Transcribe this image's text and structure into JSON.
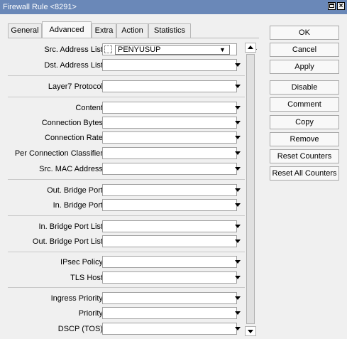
{
  "window": {
    "title": "Firewall Rule <8291>"
  },
  "tabs": [
    {
      "label": "General"
    },
    {
      "label": "Advanced"
    },
    {
      "label": "Extra"
    },
    {
      "label": "Action"
    },
    {
      "label": "Statistics"
    }
  ],
  "fields": {
    "src_address_list": {
      "label": "Src. Address List:",
      "value": "PENYUSUP"
    },
    "dst_address_list": {
      "label": "Dst. Address List:"
    },
    "layer7_protocol": {
      "label": "Layer7 Protocol:"
    },
    "content": {
      "label": "Content:"
    },
    "connection_bytes": {
      "label": "Connection Bytes:"
    },
    "connection_rate": {
      "label": "Connection Rate:"
    },
    "per_connection_classifier": {
      "label": "Per Connection Classifier:"
    },
    "src_mac_address": {
      "label": "Src. MAC Address:"
    },
    "out_bridge_port": {
      "label": "Out. Bridge Port:"
    },
    "in_bridge_port": {
      "label": "In. Bridge Port:"
    },
    "in_bridge_port_list": {
      "label": "In. Bridge Port List:"
    },
    "out_bridge_port_list": {
      "label": "Out. Bridge Port List:"
    },
    "ipsec_policy": {
      "label": "IPsec Policy:"
    },
    "tls_host": {
      "label": "TLS Host:"
    },
    "ingress_priority": {
      "label": "Ingress Priority:"
    },
    "priority": {
      "label": "Priority:"
    },
    "dscp_tos": {
      "label": "DSCP (TOS):"
    }
  },
  "buttons": {
    "ok": "OK",
    "cancel": "Cancel",
    "apply": "Apply",
    "disable": "Disable",
    "comment": "Comment",
    "copy": "Copy",
    "remove": "Remove",
    "reset_counters": "Reset Counters",
    "reset_all_counters": "Reset All Counters"
  }
}
